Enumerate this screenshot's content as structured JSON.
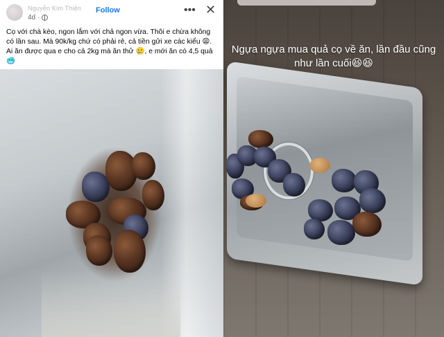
{
  "post": {
    "author": "Nguyễn Kim Thiện",
    "time": "4d",
    "follow_label": "Follow",
    "more_label": "•••",
    "close_label": "✕",
    "caption": "Cọ với chà kèo, ngon lắm với chả ngon vừa. Thôi e chừa không có lần sau. Mà 90k/kg chứ có phải rẻ, cả tiền gửi xe các kiểu 😩. Ai ăn được qua e cho cả 2kg mà ăn thử 🥲, e mới ăn có 4,5 quả 🥶"
  },
  "story": {
    "text": "Ngựa ngựa mua quả cọ về ăn, lần đầu cũng như lần cuối😆😆"
  },
  "icons": {
    "avatar": "profile-avatar",
    "globe": "globe-icon",
    "more": "more-icon",
    "close": "close-icon"
  }
}
